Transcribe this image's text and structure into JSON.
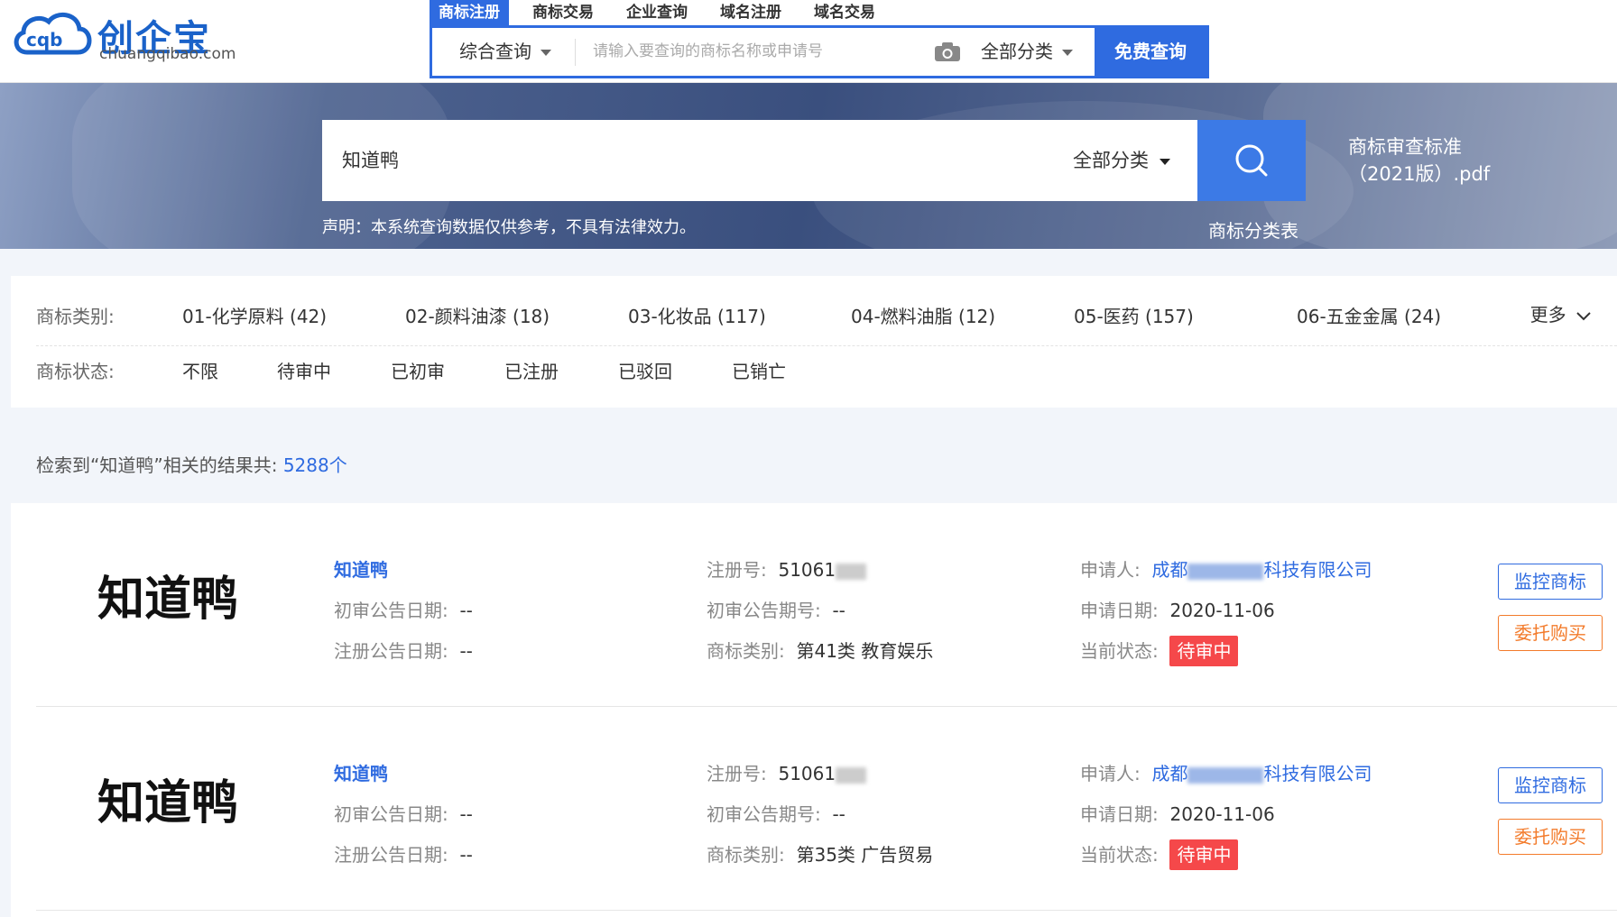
{
  "header": {
    "brand": "创企宝",
    "domain": "chuangqibao.com",
    "logo_mark": "cqb",
    "tabs": [
      "商标注册",
      "商标交易",
      "企业查询",
      "域名注册",
      "域名交易"
    ],
    "active_tab": "商标注册",
    "search_mode": "综合查询",
    "search_placeholder": "请输入要查询的商标名称或申请号",
    "category": "全部分类",
    "search_button": "免费查询"
  },
  "banner": {
    "query": "知道鸭",
    "category": "全部分类",
    "disclaimer": "声明：本系统查询数据仅供参考，不具有法律效力。",
    "class_table_link": "商标分类表",
    "pdf_line1": "商标审查标准",
    "pdf_line2": "（2021版）.pdf"
  },
  "filters": {
    "category_label": "商标类别:",
    "categories": [
      "01-化学原料 (42)",
      "02-颜料油漆 (18)",
      "03-化妆品 (117)",
      "04-燃料油脂 (12)",
      "05-医药 (157)",
      "06-五金金属 (24)"
    ],
    "more": "更多",
    "status_label": "商标状态:",
    "statuses": [
      "不限",
      "待审中",
      "已初审",
      "已注册",
      "已驳回",
      "已销亡"
    ]
  },
  "summary": {
    "prefix": "检索到“知道鸭”相关的结果共:",
    "count": "5288个"
  },
  "labels": {
    "reg_no": "注册号:",
    "prelim_date": "初审公告日期:",
    "prelim_no": "初审公告期号:",
    "reg_date": "注册公告日期:",
    "category": "商标类别:",
    "applicant": "申请人:",
    "apply_date": "申请日期:",
    "status": "当前状态:",
    "monitor_button": "监控商标",
    "buy_button": "委托购买"
  },
  "results": [
    {
      "name": "知道鸭",
      "thumb_text": "知道鸭",
      "reg_no": "51061",
      "prelim_date": "--",
      "prelim_no": "--",
      "reg_date": "--",
      "category": "第41类 教育娱乐",
      "applicant_prefix": "成都",
      "applicant_suffix": "科技有限公司",
      "apply_date": "2020-11-06",
      "status": "待审中"
    },
    {
      "name": "知道鸭",
      "thumb_text": "知道鸭",
      "reg_no": "51061",
      "prelim_date": "--",
      "prelim_no": "--",
      "reg_date": "--",
      "category": "第35类 广告贸易",
      "applicant_prefix": "成都",
      "applicant_suffix": "科技有限公司",
      "apply_date": "2020-11-06",
      "status": "待审中"
    }
  ],
  "colors": {
    "primary": "#2f6be0",
    "status_red": "#f5484a",
    "buy_orange": "#f37b2b"
  }
}
